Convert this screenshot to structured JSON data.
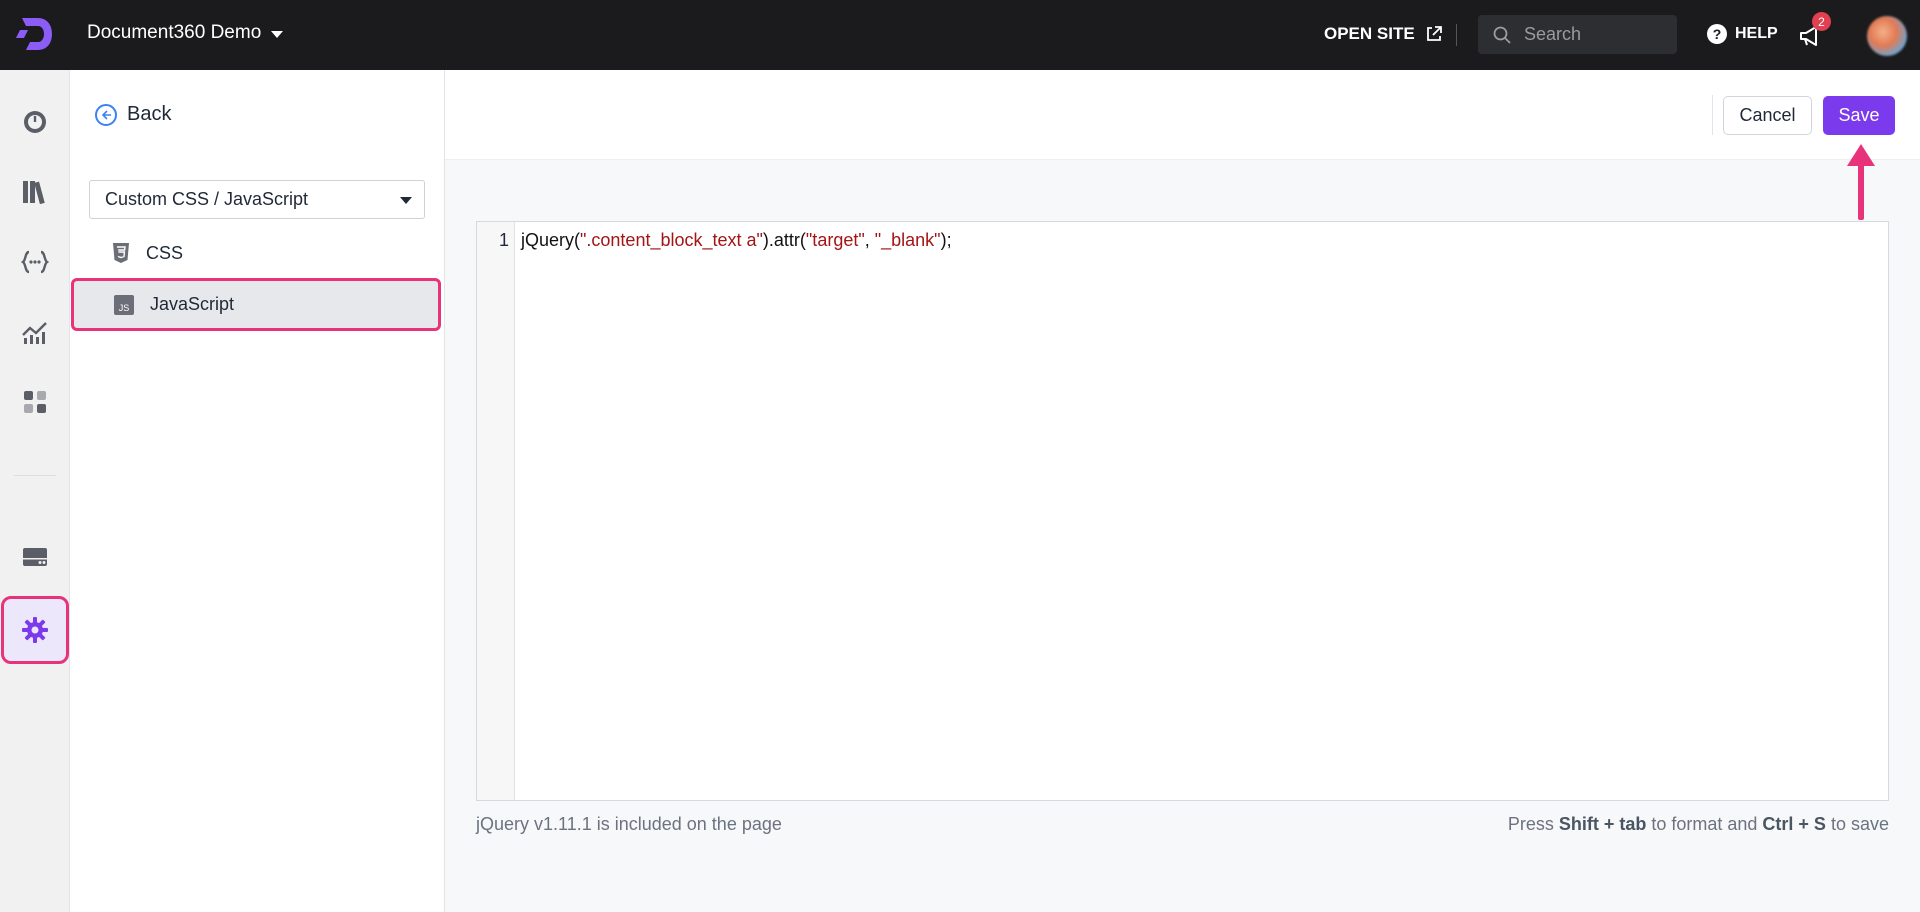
{
  "topbar": {
    "project_name": "Document360 Demo",
    "open_site_label": "OPEN SITE",
    "search_placeholder": "Search",
    "help_label": "HELP",
    "notification_count": "2",
    "help_icon_glyph": "?"
  },
  "leftnav": {
    "items": [
      {
        "name": "dashboard-icon"
      },
      {
        "name": "documentation-icon"
      },
      {
        "name": "api-documentation-icon"
      },
      {
        "name": "analytics-icon"
      },
      {
        "name": "widgets-icon"
      },
      {
        "name": "drive-icon"
      },
      {
        "name": "settings-icon",
        "active": true
      }
    ],
    "accent_color": "#7c3aed",
    "highlight_color": "#e8327a"
  },
  "header": {
    "back_label": "Back",
    "cancel_label": "Cancel",
    "save_label": "Save"
  },
  "panel": {
    "dropdown_value": "Custom CSS / JavaScript",
    "items": [
      {
        "label": "CSS",
        "icon": "css-file-icon"
      },
      {
        "label": "JavaScript",
        "icon": "js-file-icon",
        "selected": true
      }
    ]
  },
  "editor": {
    "line_number": "1",
    "code_parts": {
      "p1": "jQuery(",
      "s1": "\".content_block_text a\"",
      "p2": ").attr(",
      "s2": "\"target\"",
      "p3": ", ",
      "s3": "\"_blank\"",
      "p4": ");"
    },
    "footer_left": "jQuery v1.11.1 is included on the page",
    "footer_right": {
      "t1": "Press ",
      "k1": "Shift + tab",
      "t2": " to format and ",
      "k2": "Ctrl + S",
      "t3": " to save"
    }
  }
}
